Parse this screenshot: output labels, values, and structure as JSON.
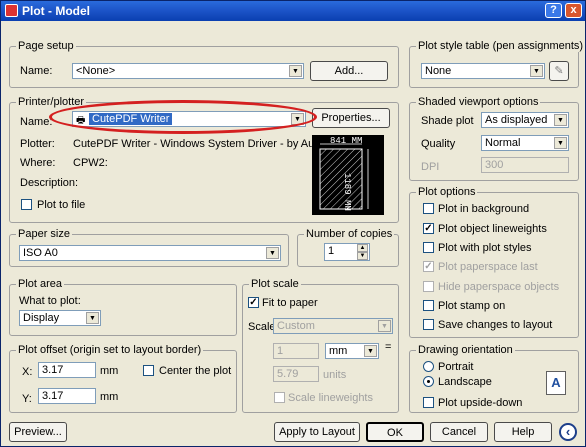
{
  "window": {
    "title": "Plot - Model",
    "help_glyph": "?",
    "close_glyph": "x"
  },
  "page_setup": {
    "group_label": "Page setup",
    "name_label": "Name:",
    "name_value": "<None>",
    "add_button": "Add..."
  },
  "printer": {
    "group_label": "Printer/plotter",
    "name_label": "Name:",
    "name_value": "CutePDF Writer",
    "properties_button": "Properties...",
    "plotter_label": "Plotter:",
    "plotter_value": "CutePDF Writer - Windows System Driver - by Autodesk",
    "where_label": "Where:",
    "where_value": "CPW2:",
    "description_label": "Description:",
    "plot_to_file_label": "Plot to file",
    "plot_to_file_checked": false,
    "preview_width": "841 MM",
    "preview_height": "1189 MM"
  },
  "paper_size": {
    "group_label": "Paper size",
    "value": "ISO A0"
  },
  "copies": {
    "group_label": "Number of copies",
    "value": "1"
  },
  "plot_area": {
    "group_label": "Plot area",
    "what_label": "What to plot:",
    "what_value": "Display"
  },
  "plot_offset": {
    "group_label": "Plot offset (origin set to layout border)",
    "x_label": "X:",
    "x_value": "3.17",
    "y_label": "Y:",
    "y_value": "3.17",
    "unit": "mm",
    "center_label": "Center the plot",
    "center_checked": false
  },
  "plot_scale": {
    "group_label": "Plot scale",
    "fit_label": "Fit to paper",
    "fit_checked": true,
    "scale_label": "Scale:",
    "scale_value": "Custom",
    "value1": "1",
    "unit1": "mm",
    "equals": "=",
    "value2": "5.79",
    "unit2": "units",
    "lineweights_label": "Scale lineweights"
  },
  "plot_style_table": {
    "group_label": "Plot style table (pen assignments)",
    "value": "None"
  },
  "shaded_viewport": {
    "group_label": "Shaded viewport options",
    "shade_label": "Shade plot",
    "shade_value": "As displayed",
    "quality_label": "Quality",
    "quality_value": "Normal",
    "dpi_label": "DPI",
    "dpi_value": "300"
  },
  "plot_options": {
    "group_label": "Plot options",
    "items": [
      {
        "label": "Plot in background",
        "checked": false,
        "disabled": false
      },
      {
        "label": "Plot object lineweights",
        "checked": true,
        "disabled": false
      },
      {
        "label": "Plot with plot styles",
        "checked": false,
        "disabled": false
      },
      {
        "label": "Plot paperspace last",
        "checked": true,
        "disabled": true
      },
      {
        "label": "Hide paperspace objects",
        "checked": false,
        "disabled": true
      },
      {
        "label": "Plot stamp on",
        "checked": false,
        "disabled": false
      },
      {
        "label": "Save changes to layout",
        "checked": false,
        "disabled": false
      }
    ]
  },
  "orientation": {
    "group_label": "Drawing orientation",
    "portrait_label": "Portrait",
    "landscape_label": "Landscape",
    "selected": "Landscape",
    "upside_down_label": "Plot upside-down",
    "page_glyph": "A"
  },
  "footer": {
    "preview_button": "Preview...",
    "apply_button": "Apply to Layout",
    "ok_button": "OK",
    "cancel_button": "Cancel",
    "help_button": "Help",
    "collapse_glyph": "‹"
  },
  "colors": {
    "title_bar": "#1d55c9",
    "highlight": "#316ac5",
    "annotation": "#d42020"
  }
}
